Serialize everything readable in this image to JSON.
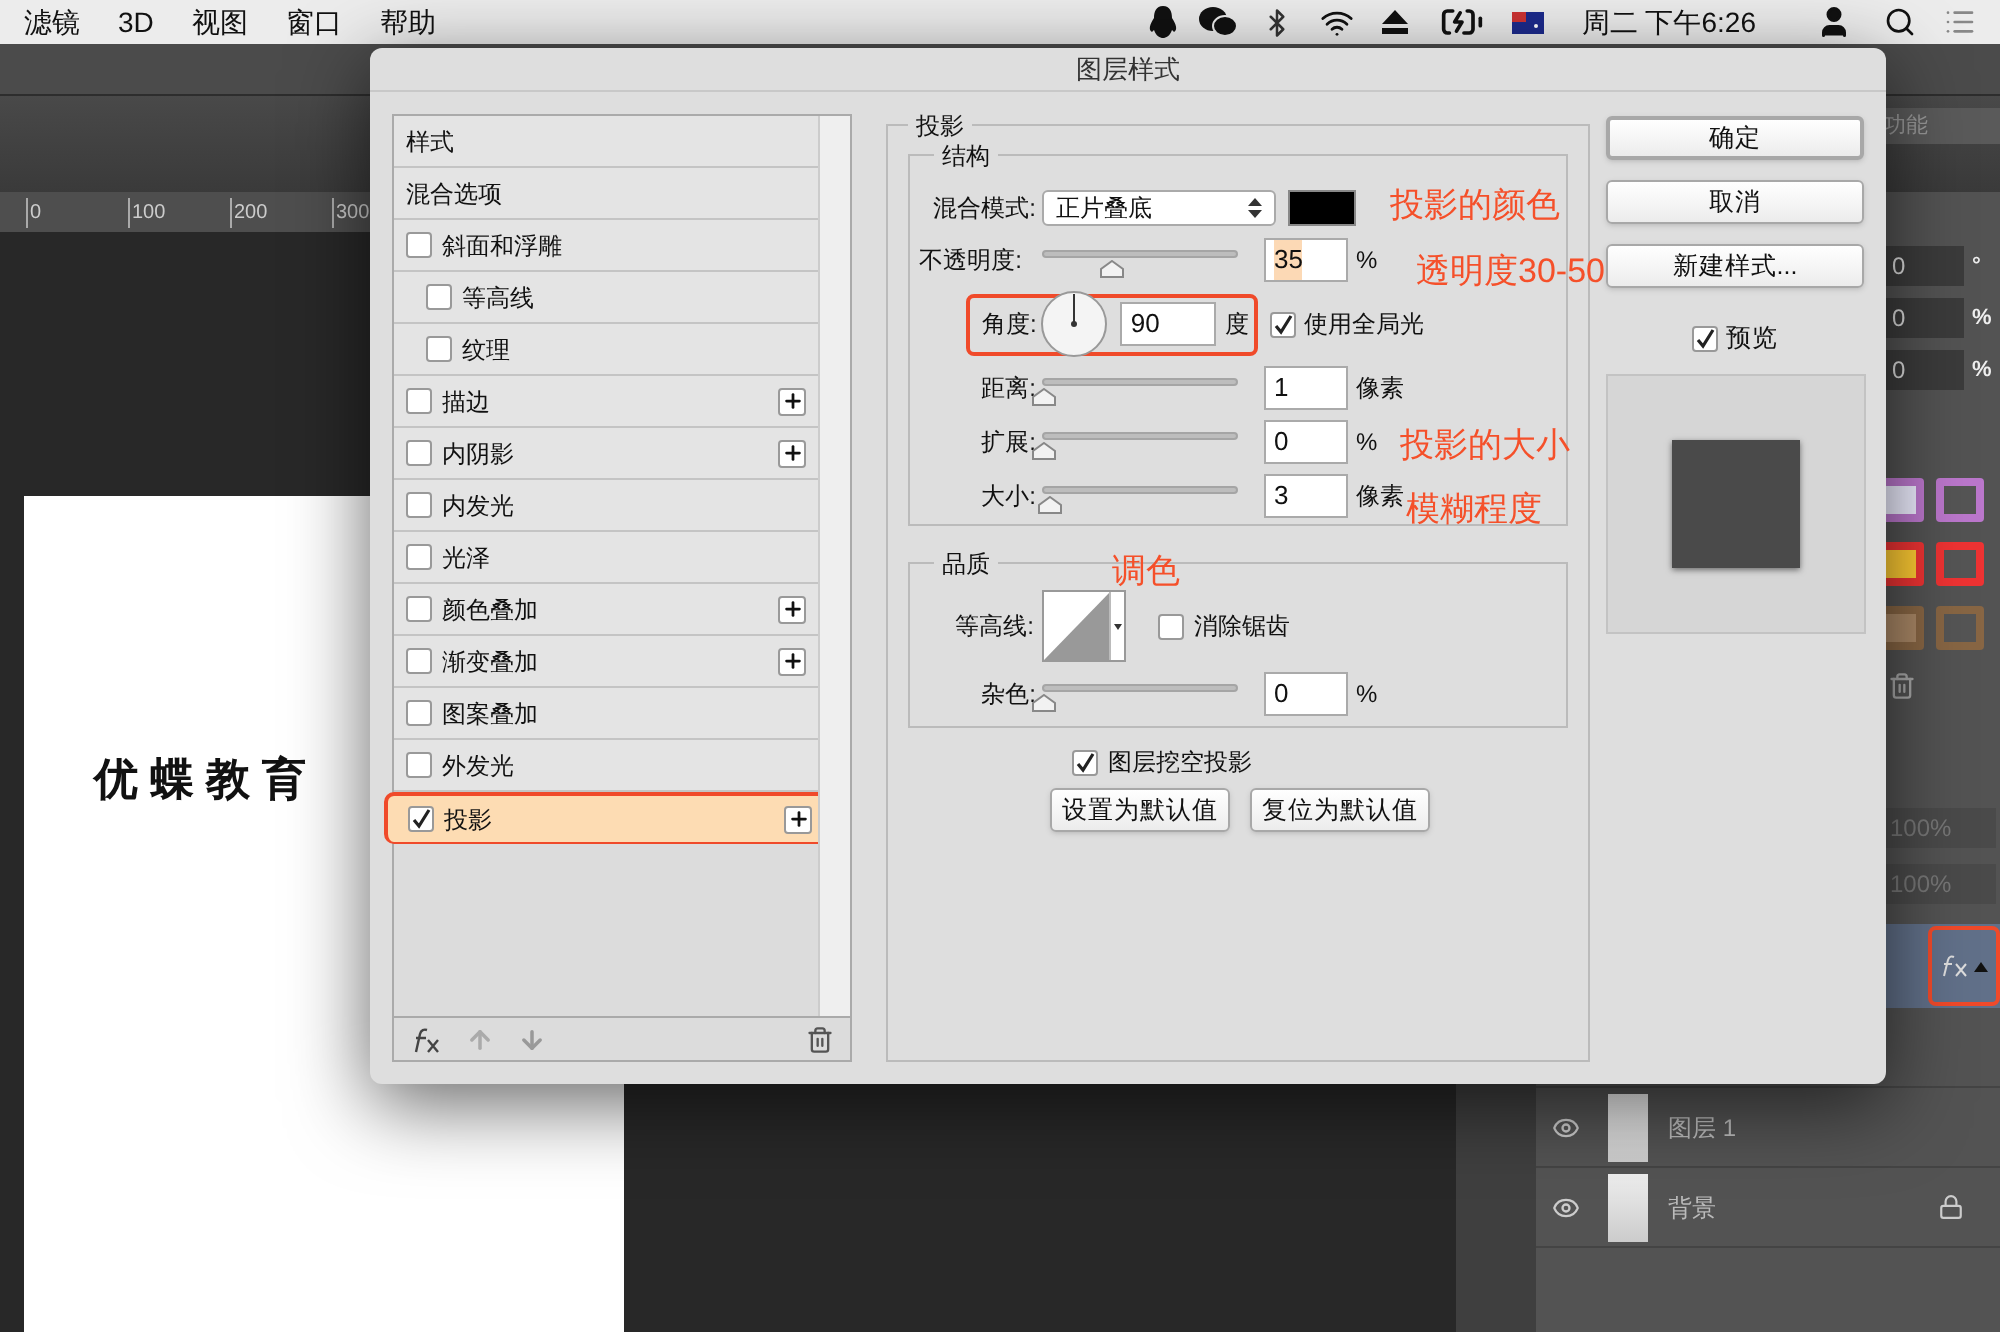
{
  "menu_bar": {
    "items": [
      "滤镜",
      "3D",
      "视图",
      "窗口",
      "帮助"
    ],
    "clock": "周二 下午6:26"
  },
  "workspace": {
    "label": "功能"
  },
  "ruler": {
    "ticks": [
      "0",
      "100",
      "200",
      "300"
    ]
  },
  "canvas": {
    "text": "优蝶教育"
  },
  "properties": [
    {
      "value": "0",
      "unit": "°"
    },
    {
      "value": "0",
      "unit": "%"
    },
    {
      "value": "0",
      "unit": "%"
    }
  ],
  "layers_panel": {
    "opacity": "100%",
    "fill": "100%",
    "active_layer": {
      "effects": true,
      "selected": true
    },
    "layers": [
      {
        "name": "图层 1",
        "visible": true,
        "locked": false,
        "selected": false
      },
      {
        "name": "背景",
        "visible": true,
        "locked": true,
        "selected": false
      }
    ]
  },
  "dialog": {
    "title": "图层样式",
    "styles": [
      {
        "label": "样式",
        "kind": "header",
        "selected": false
      },
      {
        "label": "混合选项",
        "kind": "header",
        "selected": false
      },
      {
        "label": "斜面和浮雕",
        "kind": "checkbox",
        "checked": false,
        "selected": false,
        "addable": false,
        "children": [
          {
            "label": "等高线",
            "kind": "checkbox",
            "checked": false,
            "selected": false,
            "addable": false
          },
          {
            "label": "纹理",
            "kind": "checkbox",
            "checked": false,
            "selected": false,
            "addable": false
          }
        ]
      },
      {
        "label": "描边",
        "kind": "checkbox",
        "checked": false,
        "selected": false,
        "addable": true
      },
      {
        "label": "内阴影",
        "kind": "checkbox",
        "checked": false,
        "selected": false,
        "addable": true
      },
      {
        "label": "内发光",
        "kind": "checkbox",
        "checked": false,
        "selected": false,
        "addable": false
      },
      {
        "label": "光泽",
        "kind": "checkbox",
        "checked": false,
        "selected": false,
        "addable": false
      },
      {
        "label": "颜色叠加",
        "kind": "checkbox",
        "checked": false,
        "selected": false,
        "addable": true
      },
      {
        "label": "渐变叠加",
        "kind": "checkbox",
        "checked": false,
        "selected": false,
        "addable": true
      },
      {
        "label": "图案叠加",
        "kind": "checkbox",
        "checked": false,
        "selected": false,
        "addable": false
      },
      {
        "label": "外发光",
        "kind": "checkbox",
        "checked": false,
        "selected": false,
        "addable": false
      },
      {
        "label": "投影",
        "kind": "checkbox",
        "checked": true,
        "selected": true,
        "addable": true
      }
    ],
    "section_title": "投影",
    "structure": {
      "title": "结构",
      "blend_mode": {
        "label": "混合模式:",
        "value": "正片叠底",
        "color": "#000000"
      },
      "opacity": {
        "label": "不透明度:",
        "level": 0.35,
        "value": "35",
        "unit": "%",
        "text_selected": true
      },
      "angle": {
        "label": "角度:",
        "value": "90",
        "unit": "度"
      },
      "global_light": {
        "label": "使用全局光",
        "checked": true
      },
      "sliders": [
        {
          "label": "距离:",
          "level": 0.0,
          "value": "1",
          "unit": "像素"
        },
        {
          "label": "扩展:",
          "level": 0.0,
          "value": "0",
          "unit": "%"
        },
        {
          "label": "大小:",
          "level": 0.03,
          "value": "3",
          "unit": "像素"
        }
      ]
    },
    "quality": {
      "title": "品质",
      "contour_label": "等高线:",
      "anti_alias": {
        "label": "消除锯齿",
        "checked": false
      },
      "noise": {
        "label": "杂色:",
        "level": 0.0,
        "value": "0",
        "unit": "%"
      }
    },
    "knockout": {
      "label": "图层挖空投影",
      "checked": true
    },
    "default_buttons": [
      "设置为默认值",
      "复位为默认值"
    ],
    "side_buttons": [
      "确定",
      "取消",
      "新建样式..."
    ],
    "preview": {
      "label": "预览",
      "checked": true
    }
  },
  "annotations": [
    "投影的颜色",
    "透明度30-50",
    "投影的大小",
    "模糊程度",
    "调色"
  ]
}
